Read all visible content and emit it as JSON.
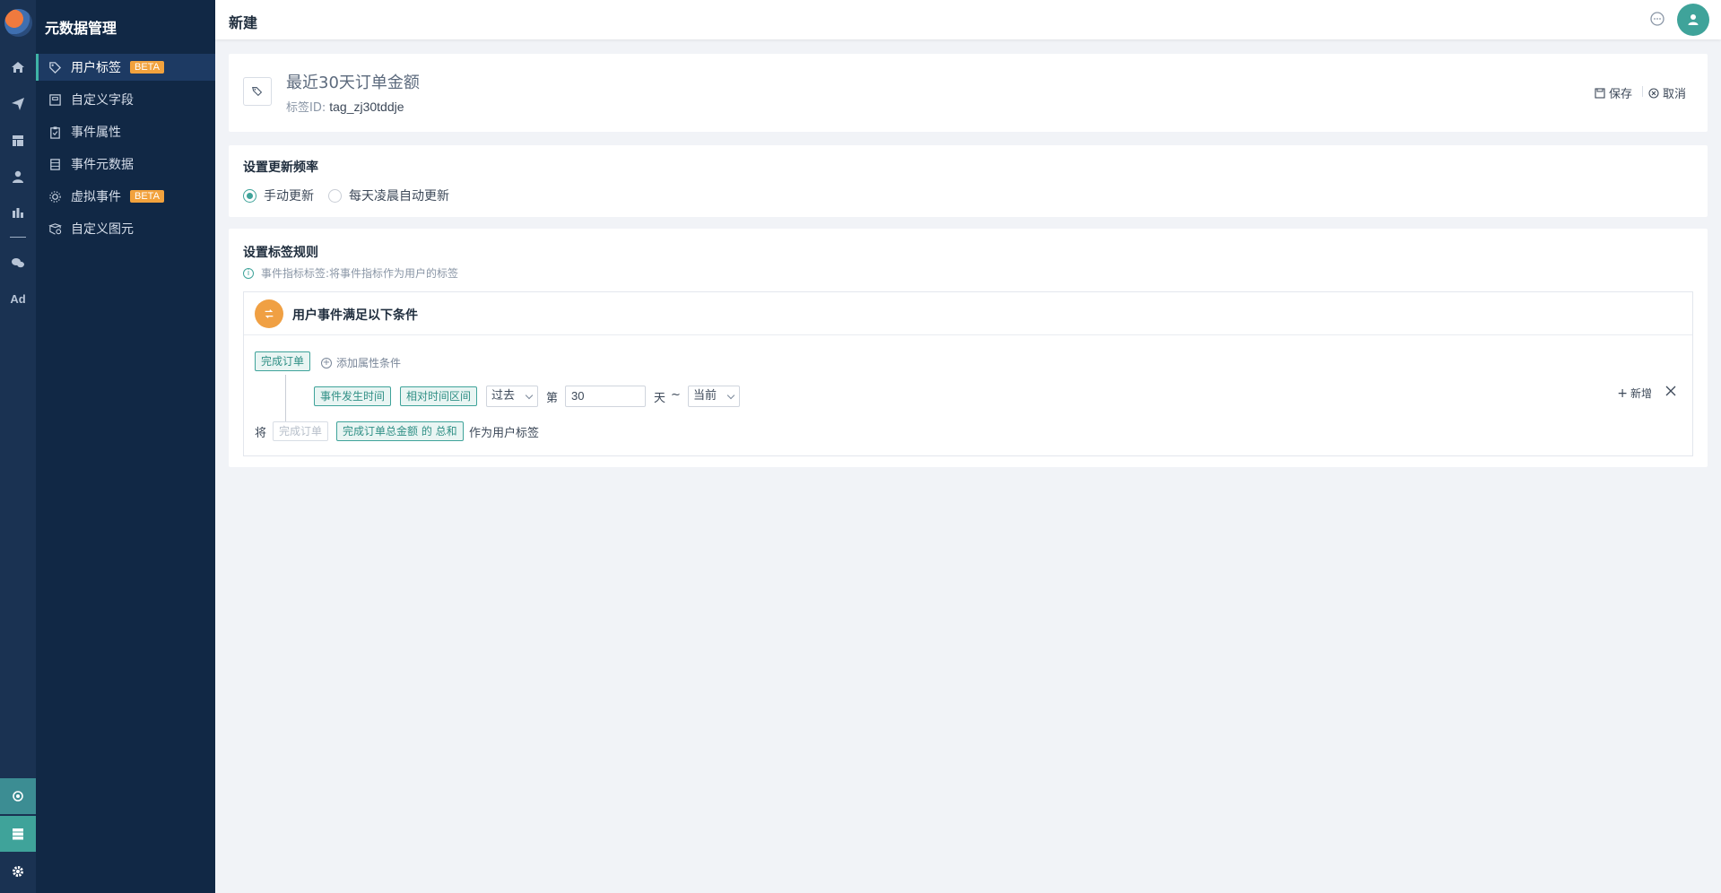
{
  "app": {
    "section_title": "元数据管理"
  },
  "sidebar": {
    "items": [
      {
        "label": "用户标签",
        "badge": "BETA",
        "icon": "tag-icon",
        "active": true
      },
      {
        "label": "自定义字段",
        "icon": "field-icon"
      },
      {
        "label": "事件属性",
        "icon": "clipboard-icon"
      },
      {
        "label": "事件元数据",
        "icon": "list-icon"
      },
      {
        "label": "虚拟事件",
        "badge": "BETA",
        "icon": "virtual-event-icon"
      },
      {
        "label": "自定义图元",
        "icon": "shapes-icon"
      }
    ]
  },
  "rail": {
    "icons": [
      "home-icon",
      "send-icon",
      "dashboard-icon",
      "user-icon",
      "bar-chart-icon",
      "wechat-icon",
      "ad-icon"
    ],
    "ad_label": "Ad",
    "bottom": [
      "hub-icon",
      "server-icon",
      "settings-icon"
    ]
  },
  "header": {
    "title": "新建"
  },
  "tag": {
    "name": "最近30天订单金额",
    "id_label": "标签ID:",
    "id_value": "tag_zj30tddje",
    "save_label": "保存",
    "cancel_label": "取消"
  },
  "frequency": {
    "title": "设置更新频率",
    "options": [
      {
        "label": "手动更新",
        "selected": true
      },
      {
        "label": "每天凌晨自动更新",
        "selected": false
      }
    ]
  },
  "rules": {
    "title": "设置标签规则",
    "hint": "事件指标标签:将事件指标作为用户的标签",
    "group_title": "用户事件满足以下条件",
    "event_chip": "完成订单",
    "add_condition": "添加属性条件",
    "condition": {
      "field": "事件发生时间",
      "operator": "相对时间区间",
      "direction": "过去",
      "prefix": "第",
      "value": "30",
      "unit": "天",
      "tilde": "~",
      "end": "当前"
    },
    "add_new": "新增",
    "footer": {
      "lead": "将",
      "event": "完成订单",
      "metric": "完成订单总金额 的 总和",
      "tail": "作为用户标签"
    }
  },
  "colors": {
    "accent": "#3fa39a",
    "sidebar": "#112845",
    "rail": "#1a3252",
    "badge": "#f2a23d",
    "group_icon": "#f0a043"
  }
}
